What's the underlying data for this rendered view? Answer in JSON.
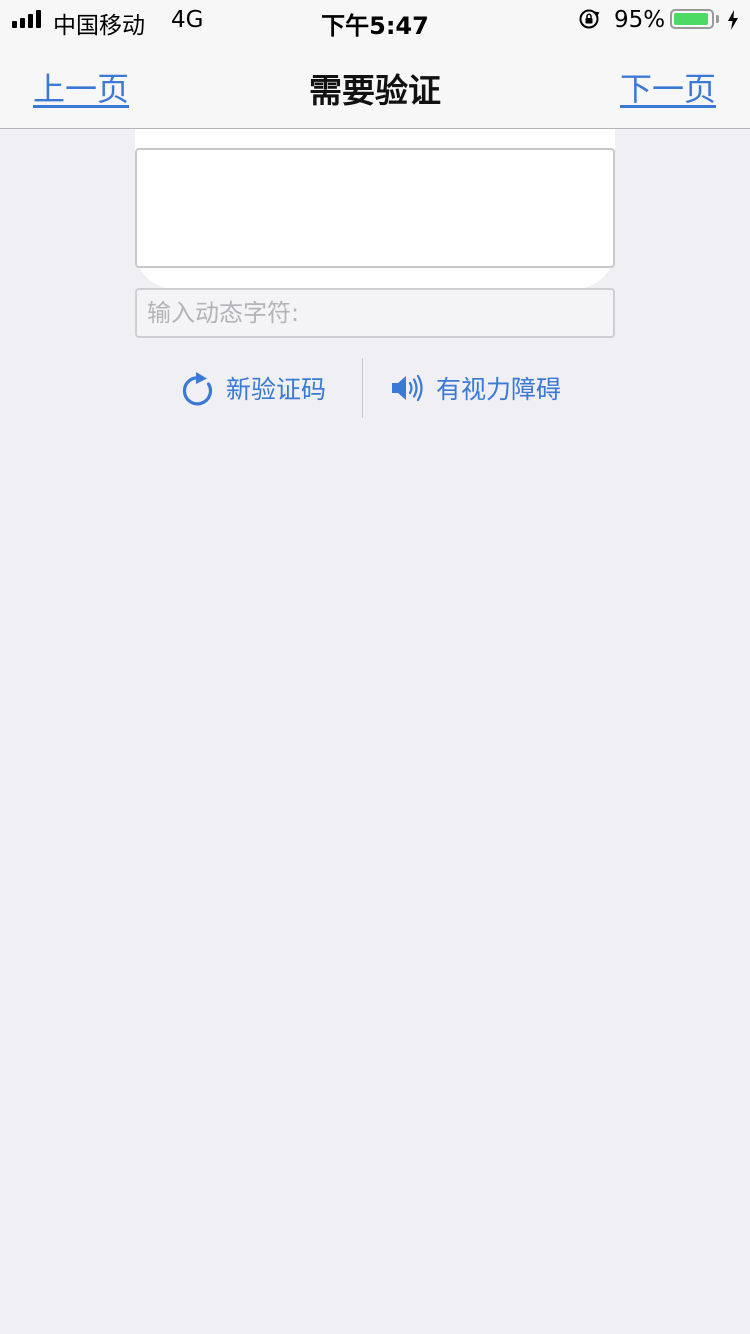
{
  "status_bar": {
    "carrier": "中国移动",
    "network": "4G",
    "time": "下午5:47",
    "battery_percent": "95%",
    "battery_level": 0.95,
    "signal_bars": 4,
    "icons": [
      "signal-icon",
      "orientation-lock-icon",
      "battery-icon",
      "charging-bolt-icon"
    ]
  },
  "nav": {
    "prev_label": "上一页",
    "title": "需要验证",
    "next_label": "下一页"
  },
  "captcha": {
    "input_value": "",
    "input_placeholder": "输入动态字符:",
    "refresh_label": "新验证码",
    "audio_label": "有视力障碍",
    "refresh_icon": "refresh-icon",
    "audio_icon": "speaker-icon"
  },
  "colors": {
    "accent": "#3a79d6",
    "background": "#efeff4",
    "bar": "#f7f7f7",
    "battery": "#4cd964"
  }
}
